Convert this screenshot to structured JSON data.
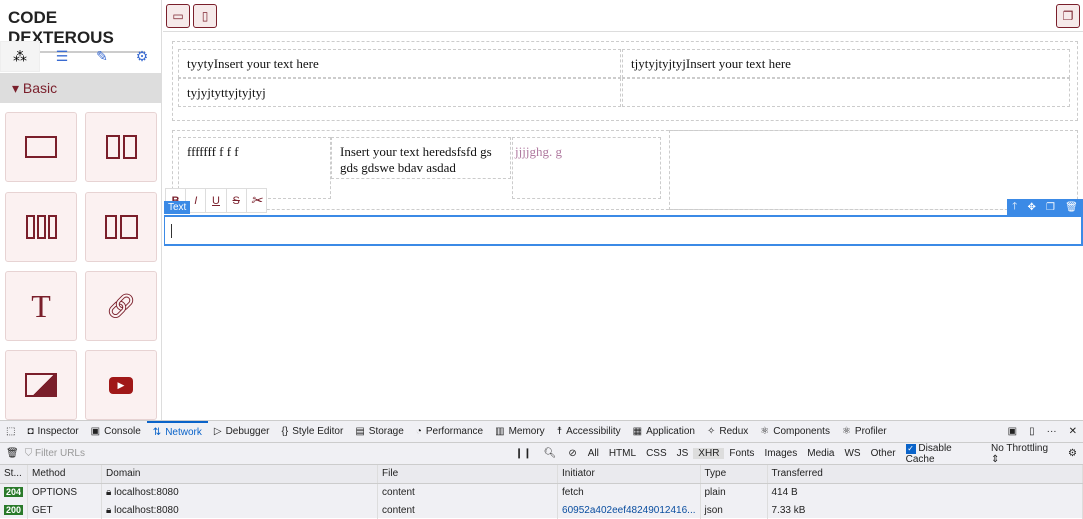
{
  "brand": "CODE DEXTEROUS",
  "sidebar": {
    "tabs": [
      "blocks-icon",
      "layers-icon",
      "style-brush-icon",
      "settings-gear-icon"
    ],
    "category": "Basic",
    "blocks": [
      "one-column-icon",
      "two-columns-icon",
      "three-columns-icon",
      "two-columns-3-7-icon",
      "text-icon",
      "link-icon",
      "image-icon",
      "video-icon"
    ],
    "text_glyph": "T"
  },
  "topbar": {
    "devices": [
      "desktop-icon",
      "mobile-icon"
    ],
    "right": "copy-icon"
  },
  "canvas": {
    "row1": [
      "tyytyInsert your text here",
      "tjytyjtyjtyjInsert your text here",
      "tyjyjtyttyjtyjtyj"
    ],
    "row2": [
      "fffffff f   f f",
      "Insert your text heredsfsfd   gs gds gdswe bdav asdad",
      "jjjjghg. g"
    ],
    "rte": [
      "B",
      "I",
      "U",
      "S",
      "unlink-icon"
    ],
    "badge": "Text",
    "tools": [
      "arrow-up-icon",
      "move-icon",
      "clone-icon",
      "delete-icon"
    ],
    "accent": "#3b8ae6",
    "brand_color": "#7a1f2b"
  },
  "devtools": {
    "tabs": [
      "Inspector",
      "Console",
      "Network",
      "Debugger",
      "Style Editor",
      "Storage",
      "Performance",
      "Memory",
      "Accessibility",
      "Application",
      "Redux",
      "Components",
      "Profiler"
    ],
    "active_tab": "Network",
    "filter_placeholder": "Filter URLs",
    "filters": [
      "All",
      "HTML",
      "CSS",
      "JS",
      "XHR",
      "Fonts",
      "Images",
      "Media",
      "WS",
      "Other"
    ],
    "active_filter": "XHR",
    "disable_cache": "Disable Cache",
    "disable_cache_checked": true,
    "throttling": "No Throttling ⇕",
    "columns": [
      "St...",
      "Method",
      "Domain",
      "File",
      "Initiator",
      "Type",
      "Transferred"
    ],
    "rows": [
      {
        "status": "204",
        "method": "OPTIONS",
        "domain": "localhost:8080",
        "file": "content",
        "initiator": "fetch",
        "type": "plain",
        "transferred": "414 B"
      },
      {
        "status": "200",
        "method": "GET",
        "domain": "localhost:8080",
        "file": "content",
        "initiator": "60952a402eef48249012416...",
        "type": "json",
        "transferred": "7.33 kB"
      }
    ]
  }
}
